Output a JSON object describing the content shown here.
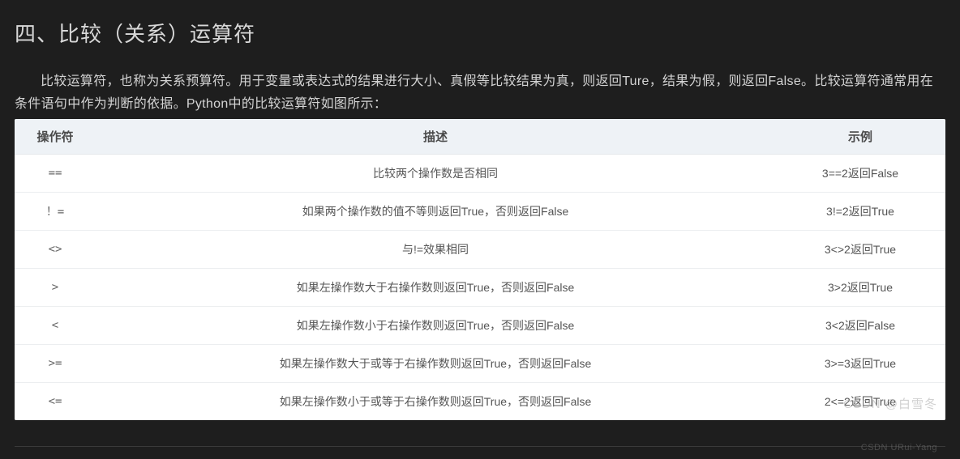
{
  "title": "四、比较（关系）运算符",
  "intro": "比较运算符，也称为关系预算符。用于变量或表达式的结果进行大小、真假等比较结果为真，则返回Ture，结果为假，则返回False。比较运算符通常用在条件语句中作为判断的依据。Python中的比较运算符如图所示：",
  "table": {
    "headers": [
      "操作符",
      "描述",
      "示例"
    ],
    "rows": [
      {
        "op": "==",
        "desc": "比较两个操作数是否相同",
        "example": "3==2返回False"
      },
      {
        "op": "！=",
        "desc": "如果两个操作数的值不等则返回True，否则返回False",
        "example": "3!=2返回True"
      },
      {
        "op": "<>",
        "desc": "与!=效果相同",
        "example": "3<>2返回True"
      },
      {
        "op": ">",
        "desc": "如果左操作数大于右操作数则返回True，否则返回False",
        "example": "3>2返回True"
      },
      {
        "op": "<",
        "desc": "如果左操作数小于右操作数则返回True，否则返回False",
        "example": "3<2返回False"
      },
      {
        "op": ">=",
        "desc": "如果左操作数大于或等于右操作数则返回True，否则返回False",
        "example": "3>=3返回True"
      },
      {
        "op": "<=",
        "desc": "如果左操作数小于或等于右操作数则返回True，否则返回False",
        "example": "2<=2返回True"
      }
    ]
  },
  "watermark1": "CSDN @白雪冬",
  "watermark2": "CSDN URui-Yang"
}
